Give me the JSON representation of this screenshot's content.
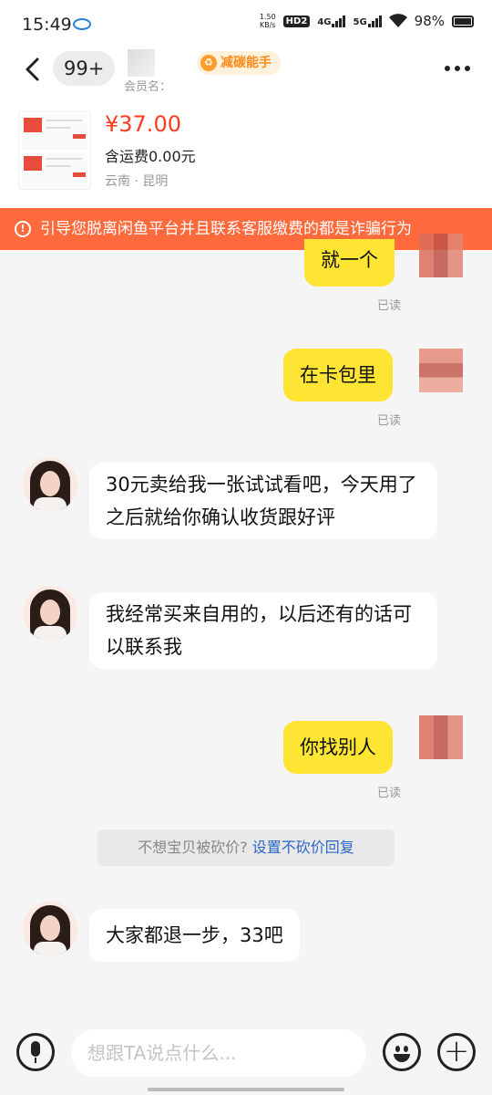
{
  "status_bar": {
    "time": "15:49",
    "speed_value": "1.50",
    "speed_unit": "KB/s",
    "hd": "HD2",
    "net1": "4G",
    "net2": "5G",
    "battery": "98%"
  },
  "header": {
    "unread_count": "99+",
    "badge_text": "减碳能手",
    "member_label": "会员名："
  },
  "product": {
    "price": "¥37.00",
    "shipping": "含运费0.00元",
    "location": "云南 · 昆明"
  },
  "warning": {
    "text": "引导您脱离闲鱼平台并且联系客服缴费的都是诈骗行为"
  },
  "messages": [
    {
      "sender": "me",
      "text": "就一个",
      "status": "已读"
    },
    {
      "sender": "me",
      "text": "在卡包里",
      "status": "已读"
    },
    {
      "sender": "them",
      "text": "30元卖给我一张试试看吧，今天用了之后就给你确认收货跟好评"
    },
    {
      "sender": "them",
      "text": "我经常买来自用的，以后还有的话可以联系我"
    },
    {
      "sender": "me",
      "text": "你找别人",
      "status": "已读"
    },
    {
      "sender": "them",
      "text": "大家都退一步，33吧"
    }
  ],
  "system_tip": {
    "text": "不想宝贝被砍价? ",
    "link": "设置不砍价回复"
  },
  "input": {
    "placeholder": "想跟TA说点什么..."
  }
}
